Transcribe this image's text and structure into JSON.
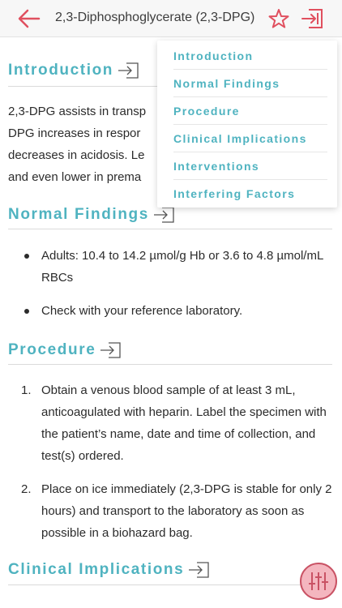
{
  "header": {
    "title": "2,3-Diphosphoglycerate (2,3-DPG)",
    "back_icon": "back-arrow-icon",
    "favorite_icon": "star-icon",
    "toc_icon": "jump-to-section-icon"
  },
  "colors": {
    "accent": "#4fb3c0",
    "brand_red": "#e0505f",
    "fab_fill": "#f4b6bf",
    "fab_stroke": "#c95264"
  },
  "toc": {
    "items": [
      "Introduction",
      "Normal Findings",
      "Procedure",
      "Clinical Implications",
      "Interventions",
      "Interfering Factors"
    ]
  },
  "sections": {
    "introduction": {
      "heading": "Introduction",
      "lines": [
        "2,3-DPG assists in transp",
        "DPG increases in respor",
        "decreases in acidosis. Le",
        "and even lower in prema"
      ]
    },
    "normal_findings": {
      "heading": "Normal Findings",
      "bullets": [
        "Adults: 10.4 to 14.2 µmol/g Hb or 3.6 to 4.8 µmol/mL RBCs",
        "Check with your reference laboratory."
      ]
    },
    "procedure": {
      "heading": "Procedure",
      "steps": [
        {
          "n": "1.",
          "text": "Obtain a venous blood sample of at least 3 mL, anticoagulated with heparin. Label the specimen with the patient’s name, date and time of collection, and test(s) ordered."
        },
        {
          "n": "2.",
          "text": "Place on ice immediately (2,3-DPG is stable for only 2 hours) and transport to the laboratory as soon as possible in a biohazard bag."
        }
      ]
    },
    "clinical_implications": {
      "heading": "Clinical Implications"
    }
  },
  "fab": {
    "icon": "adjust-sliders-icon"
  }
}
